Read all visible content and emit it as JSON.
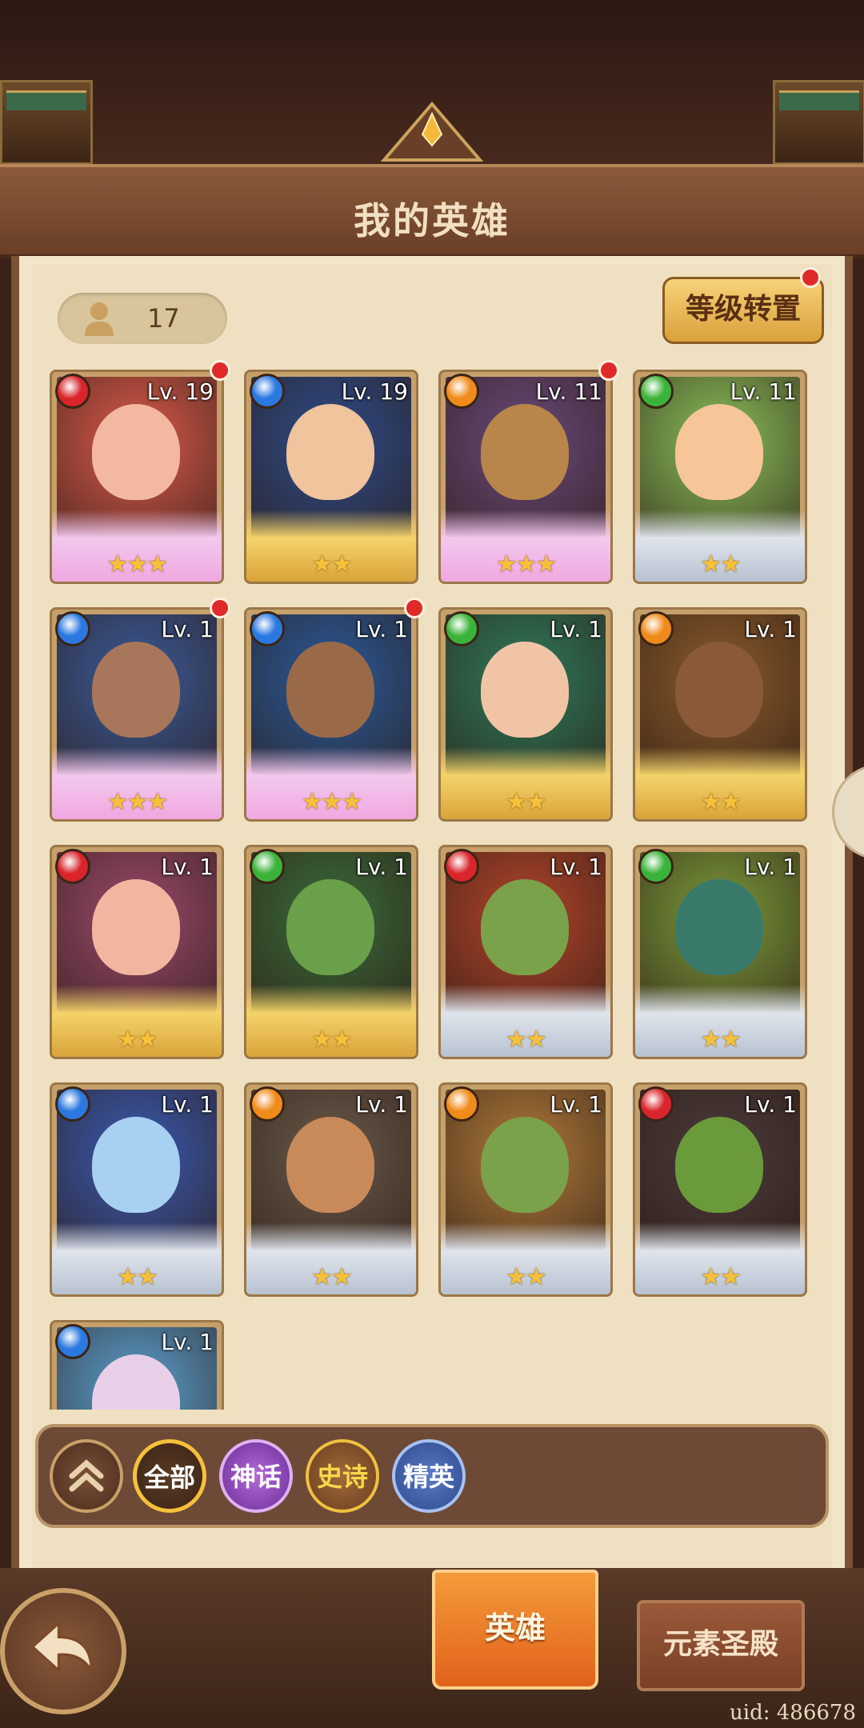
{
  "header": {
    "title": "我的英雄"
  },
  "hero_count": "17",
  "level_transfer_button": "等级转置",
  "heroes": [
    {
      "level": "Lv. 19",
      "stars": "★★★",
      "element": "fire",
      "element_color": "#d8242a",
      "art_color": "#d95a4a",
      "face_color": "#f3b8a0",
      "frame": "mythic",
      "dot": true
    },
    {
      "level": "Lv. 19",
      "stars": "★★",
      "element": "water",
      "element_color": "#2a78e0",
      "art_color": "#2e4c8a",
      "face_color": "#f0c49c",
      "frame": "epic",
      "dot": false
    },
    {
      "level": "Lv. 11",
      "stars": "★★★",
      "element": "earth",
      "element_color": "#f08a1a",
      "art_color": "#6a4a7a",
      "face_color": "#b8864a",
      "frame": "mythic",
      "dot": true
    },
    {
      "level": "Lv. 11",
      "stars": "★★",
      "element": "wind",
      "element_color": "#3bb33a",
      "art_color": "#8ac05a",
      "face_color": "#f6c59a",
      "frame": "elite",
      "dot": false
    },
    {
      "level": "Lv. 1",
      "stars": "★★★",
      "element": "water",
      "element_color": "#2a78e0",
      "art_color": "#3a5a9a",
      "face_color": "#a8765a",
      "frame": "mythic",
      "dot": true
    },
    {
      "level": "Lv. 1",
      "stars": "★★★",
      "element": "water",
      "element_color": "#2a78e0",
      "art_color": "#2a5a9a",
      "face_color": "#9a6a48",
      "frame": "mythic",
      "dot": true
    },
    {
      "level": "Lv. 1",
      "stars": "★★",
      "element": "wind",
      "element_color": "#3bb33a",
      "art_color": "#2e7a5a",
      "face_color": "#f2c4a6",
      "frame": "epic",
      "dot": false
    },
    {
      "level": "Lv. 1",
      "stars": "★★",
      "element": "earth",
      "element_color": "#f08a1a",
      "art_color": "#8a5a2a",
      "face_color": "#8a5a38",
      "frame": "epic",
      "dot": false
    },
    {
      "level": "Lv. 1",
      "stars": "★★",
      "element": "fire",
      "element_color": "#d8242a",
      "art_color": "#9a4a6a",
      "face_color": "#f2b6a0",
      "frame": "epic",
      "dot": false
    },
    {
      "level": "Lv. 1",
      "stars": "★★",
      "element": "wind",
      "element_color": "#3bb33a",
      "art_color": "#3a6a3a",
      "face_color": "#6aa04a",
      "frame": "epic",
      "dot": false
    },
    {
      "level": "Lv. 1",
      "stars": "★★",
      "element": "fire",
      "element_color": "#d8242a",
      "art_color": "#b2452a",
      "face_color": "#7aa24a",
      "frame": "elite",
      "dot": false
    },
    {
      "level": "Lv. 1",
      "stars": "★★",
      "element": "wind",
      "element_color": "#3bb33a",
      "art_color": "#7a9a3a",
      "face_color": "#3a7a6a",
      "frame": "elite",
      "dot": false
    },
    {
      "level": "Lv. 1",
      "stars": "★★",
      "element": "water",
      "element_color": "#2a78e0",
      "art_color": "#3a5ab0",
      "face_color": "#a8d0f0",
      "frame": "elite",
      "dot": false
    },
    {
      "level": "Lv. 1",
      "stars": "★★",
      "element": "earth",
      "element_color": "#f08a1a",
      "art_color": "#6a5a4a",
      "face_color": "#c98a5a",
      "frame": "elite",
      "dot": false
    },
    {
      "level": "Lv. 1",
      "stars": "★★",
      "element": "earth",
      "element_color": "#f08a1a",
      "art_color": "#b07a3a",
      "face_color": "#7aa24a",
      "frame": "elite",
      "dot": false
    },
    {
      "level": "Lv. 1",
      "stars": "★★",
      "element": "fire",
      "element_color": "#d8242a",
      "art_color": "#4a3a3a",
      "face_color": "#6a9a3a",
      "frame": "elite",
      "dot": false
    },
    {
      "level": "Lv. 1",
      "stars": "",
      "element": "water",
      "element_color": "#2a78e0",
      "art_color": "#5aa0d0",
      "face_color": "#e8d0e8",
      "frame": "elite",
      "dot": false
    }
  ],
  "filters": {
    "collapse_icon": "double-chevron-up-icon",
    "all": "全部",
    "mythic": "神话",
    "epic": "史诗",
    "elite": "精英"
  },
  "tabs": {
    "heroes": "英雄",
    "temple": "元素圣殿"
  },
  "uid": "uid: 486678"
}
